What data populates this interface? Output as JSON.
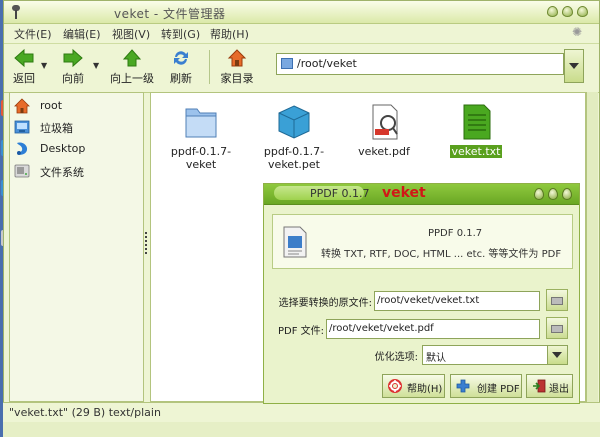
{
  "window": {
    "title": "veket - 文件管理器",
    "accent": "#b9cb81"
  },
  "menubar": {
    "items": [
      "文件(E)",
      "编辑(E)",
      "视图(V)",
      "转到(G)",
      "帮助(H)"
    ]
  },
  "toolbar": {
    "back": "返回",
    "forward": "向前",
    "up": "向上一级",
    "refresh": "刷新",
    "home": "家目录"
  },
  "address": {
    "path": "/root/veket"
  },
  "sidebar": {
    "items": [
      {
        "label": "root",
        "icon": "home-icon"
      },
      {
        "label": "垃圾箱",
        "icon": "trash-icon"
      },
      {
        "label": "Desktop",
        "icon": "desktop-icon"
      },
      {
        "label": "文件系统",
        "icon": "drive-icon"
      }
    ]
  },
  "files": [
    {
      "name": "ppdf-0.1.7-veket",
      "icon": "folder-icon"
    },
    {
      "name": "ppdf-0.1.7-\nveket.pet",
      "icon": "package-icon"
    },
    {
      "name": "veket.pdf",
      "icon": "pdf-icon"
    },
    {
      "name": "veket.txt",
      "icon": "text-file-icon",
      "selected": true
    }
  ],
  "status": {
    "text": "\"veket.txt\" (29 B) text/plain"
  },
  "dialog": {
    "title": "PPDF 0.1.7",
    "brand": "veket",
    "brand_color": "#d01717",
    "info_title": "PPDF 0.1.7",
    "info_desc": "转换 TXT, RTF, DOC, HTML ... etc. 等等文件为 PDF",
    "source_label": "选择要转换的原文件:",
    "source_value": "/root/veket/veket.txt",
    "pdf_label": "PDF 文件:",
    "pdf_value": "/root/veket/veket.pdf",
    "opt_label": "优化选项:",
    "opt_value": "默认",
    "help_button": "帮助(H)",
    "create_button": "创建 PDF",
    "quit_button": "退出"
  }
}
